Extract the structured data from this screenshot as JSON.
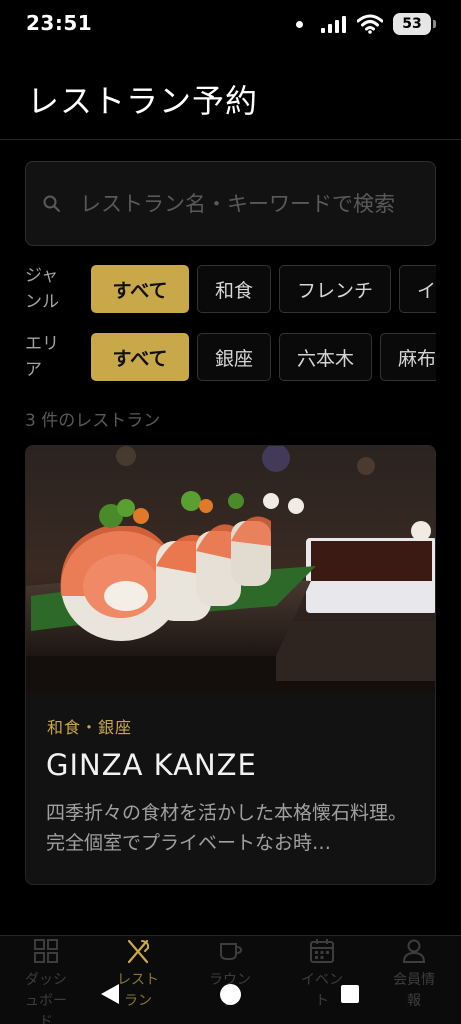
{
  "status_bar": {
    "time": "23:51",
    "battery": "53"
  },
  "header": {
    "title": "レストラン予約"
  },
  "search": {
    "placeholder": "レストラン名・キーワードで検索"
  },
  "genre_filter": {
    "label": "ジャンル",
    "chips": [
      "すべて",
      "和食",
      "フレンチ",
      "イタリアン"
    ],
    "selected": "すべて"
  },
  "area_filter": {
    "label": "エリア",
    "chips": [
      "すべて",
      "銀座",
      "六本木",
      "麻布"
    ],
    "selected": "すべて"
  },
  "results": {
    "count_text": "3 件のレストラン"
  },
  "restaurants": [
    {
      "category": "和食・銀座",
      "name": "GINZA KANZE",
      "description": "四季折々の食材を活かした本格懐石料理。完全個室でプライベートなお時…"
    }
  ],
  "bottom_nav": [
    {
      "label": "ダッシュボード",
      "icon": "grid-icon",
      "active": false
    },
    {
      "label": "レストラン",
      "icon": "utensils-icon",
      "active": true
    },
    {
      "label": "ラウンジ",
      "icon": "cup-icon",
      "active": false
    },
    {
      "label": "イベント",
      "icon": "calendar-icon",
      "active": false
    },
    {
      "label": "会員情報",
      "icon": "user-icon",
      "active": false
    }
  ],
  "colors": {
    "accent": "#c9a84a",
    "background": "#000000",
    "card": "#121212"
  }
}
